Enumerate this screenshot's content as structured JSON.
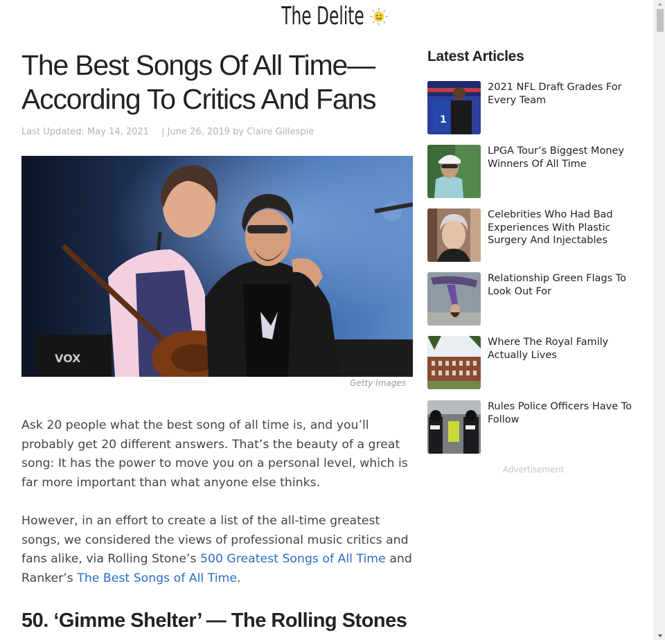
{
  "site": {
    "logo_text": "The Delite"
  },
  "article": {
    "title": "The Best Songs Of All Time—According To Critics And Fans",
    "meta": {
      "updated": "Last Updated: May 14, 2021",
      "published": "| June 26, 2019 by",
      "author": "Claire Gillespie"
    },
    "image_credit": "Getty Images",
    "p1": "Ask 20 people what the best song of all time is, and you’ll probably get 20 different answers. That’s the beauty of a great song: It has the power to move you on a personal level, which is far more important than what anyone else thinks.",
    "p2": {
      "text_before": "However, in an effort to create a list of the all-time greatest songs, we considered the views of professional music critics and fans alike, via Rolling Stone’s ",
      "link1": "500 Greatest Songs of All Time",
      "text_middle": " and Ranker’s ",
      "link2": "The Best Songs of All Time",
      "text_after": "."
    },
    "section_heading": "50. ‘Gimme Shelter’ — The Rolling Stones"
  },
  "sidebar": {
    "title": "Latest Articles",
    "articles": [
      {
        "title": "2021 NFL Draft Grades For Every Team",
        "thumb": "nfl-draft-photo"
      },
      {
        "title": "LPGA Tour’s Biggest Money Winners Of All Time",
        "thumb": "golfer-photo"
      },
      {
        "title": "Celebrities Who Had Bad Experiences With Plastic Surgery And Injectables",
        "thumb": "celebrity-photo"
      },
      {
        "title": "Relationship Green Flags To Look Out For",
        "thumb": "couple-photo"
      },
      {
        "title": "Where The Royal Family Actually Lives",
        "thumb": "palace-photo"
      },
      {
        "title": "Rules Police Officers Have To Follow",
        "thumb": "police-photo"
      }
    ],
    "ad_label": "Advertisement"
  },
  "colors": {
    "link": "#2a6cc7",
    "meta": "#b3b3b3",
    "text": "#444444",
    "heading": "#222222"
  }
}
